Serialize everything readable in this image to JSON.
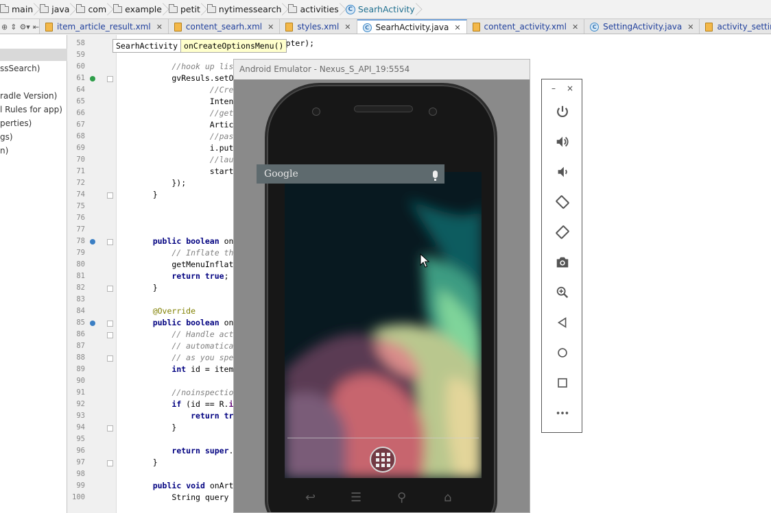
{
  "breadcrumb": [
    "main",
    "java",
    "com",
    "example",
    "petit",
    "nytimessearch",
    "activities",
    "SearhActivity"
  ],
  "tabs": [
    {
      "label": "item_article_result.xml",
      "type": "xml"
    },
    {
      "label": "content_searh.xml",
      "type": "xml"
    },
    {
      "label": "styles.xml",
      "type": "xml"
    },
    {
      "label": "SearhActivity.java",
      "type": "class",
      "active": true
    },
    {
      "label": "content_activity.xml",
      "type": "xml"
    },
    {
      "label": "SettingActivity.java",
      "type": "class"
    },
    {
      "label": "activity_setting_activity.xml",
      "type": "xml"
    }
  ],
  "project_items": [
    "ssSearch)",
    "radle Version)",
    "l Rules for app)",
    "perties)",
    "gs)",
    "n)"
  ],
  "hint": {
    "class_name": "SearhActivity",
    "method_name": "onCreateOptionsMenu()"
  },
  "line_numbers": [
    "58",
    "59",
    "60",
    "61",
    "64",
    "65",
    "66",
    "67",
    "68",
    "69",
    "70",
    "71",
    "72",
    "74",
    "75",
    "76",
    "77",
    "78",
    "79",
    "80",
    "81",
    "82",
    "83",
    "84",
    "85",
    "86",
    "87",
    "88",
    "89",
    "90",
    "91",
    "92",
    "93",
    "94",
    "95",
    "96",
    "97",
    "98",
    "99",
    "100"
  ],
  "code_lines": [
    "        gvResults.setAdapter(adapter);",
    "",
    "        //hook up listenn",
    "        gvResuls.setOnIte",
    "                //Create",
    "                Intent i",
    "                //get the",
    "                Article a",
    "                //pass in",
    "                i.putExtr",
    "                //launch",
    "                startActi",
    "        });",
    "    }",
    "",
    "",
    "",
    "    public boolean onCrea",
    "        // Inflate the me",
    "        getMenuInflater()",
    "        return true;",
    "    }",
    "",
    "    @Override",
    "    public boolean onOpti",
    "        // Handle action",
    "        // automatically",
    "        // as you specify",
    "        int id = item.get",
    "",
    "        //noinspection Si",
    "        if (id == R.id.ac",
    "            return true;",
    "        }",
    "",
    "        return super.onOp",
    "    }",
    "",
    "    public void onArticle",
    "        String query = et"
  ],
  "emulator": {
    "title": "Android Emulator - Nexus_S_API_19:5554",
    "search_label": "Google"
  },
  "controls": {
    "minimize": "–",
    "close": "×",
    "buttons": [
      "power-icon",
      "volume-up-icon",
      "volume-down-icon",
      "rotate-left-icon",
      "rotate-right-icon",
      "camera-icon",
      "zoom-icon",
      "back-icon",
      "home-icon",
      "overview-icon",
      "more-icon"
    ]
  }
}
